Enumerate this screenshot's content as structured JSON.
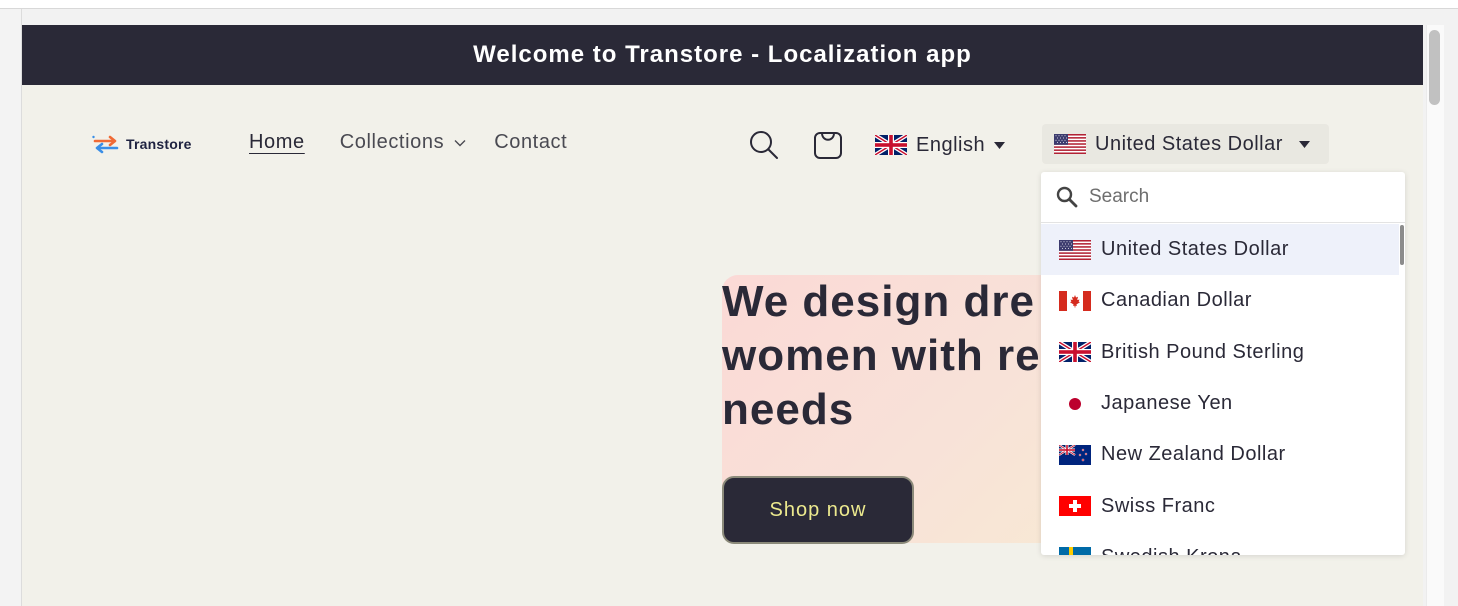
{
  "announcement": {
    "text": "Welcome to Transtore - Localization app"
  },
  "brand": {
    "name": "Transtore",
    "accent_blue": "#3a8ee6",
    "accent_orange": "#f06a35"
  },
  "nav": {
    "home": "Home",
    "collections": "Collections",
    "contact": "Contact"
  },
  "header": {
    "search_icon": "search-icon",
    "cart_icon": "cart-icon",
    "language": {
      "label": "English",
      "flag": "uk-flag-icon"
    },
    "currency": {
      "label": "United States Dollar",
      "flag": "us-flag-icon"
    }
  },
  "hero": {
    "heading_line1": "We design dre",
    "heading_line2": "women with re",
    "heading_line3": "needs",
    "button_label": "Shop now"
  },
  "currency_dropdown": {
    "search_placeholder": "Search",
    "items": [
      {
        "label": "United States Dollar",
        "flag": "us",
        "selected": true
      },
      {
        "label": "Canadian Dollar",
        "flag": "ca",
        "selected": false
      },
      {
        "label": "British Pound Sterling",
        "flag": "gb",
        "selected": false
      },
      {
        "label": "Japanese Yen",
        "flag": "jp",
        "selected": false
      },
      {
        "label": "New Zealand Dollar",
        "flag": "nz",
        "selected": false
      },
      {
        "label": "Swiss Franc",
        "flag": "ch",
        "selected": false
      },
      {
        "label": "Swedish Krona",
        "flag": "se",
        "selected": false
      }
    ]
  },
  "colors": {
    "dark": "#2a2937",
    "page_bg": "#f2f1ea",
    "button_text": "#ece98e",
    "selected_row": "#eef1fa"
  }
}
